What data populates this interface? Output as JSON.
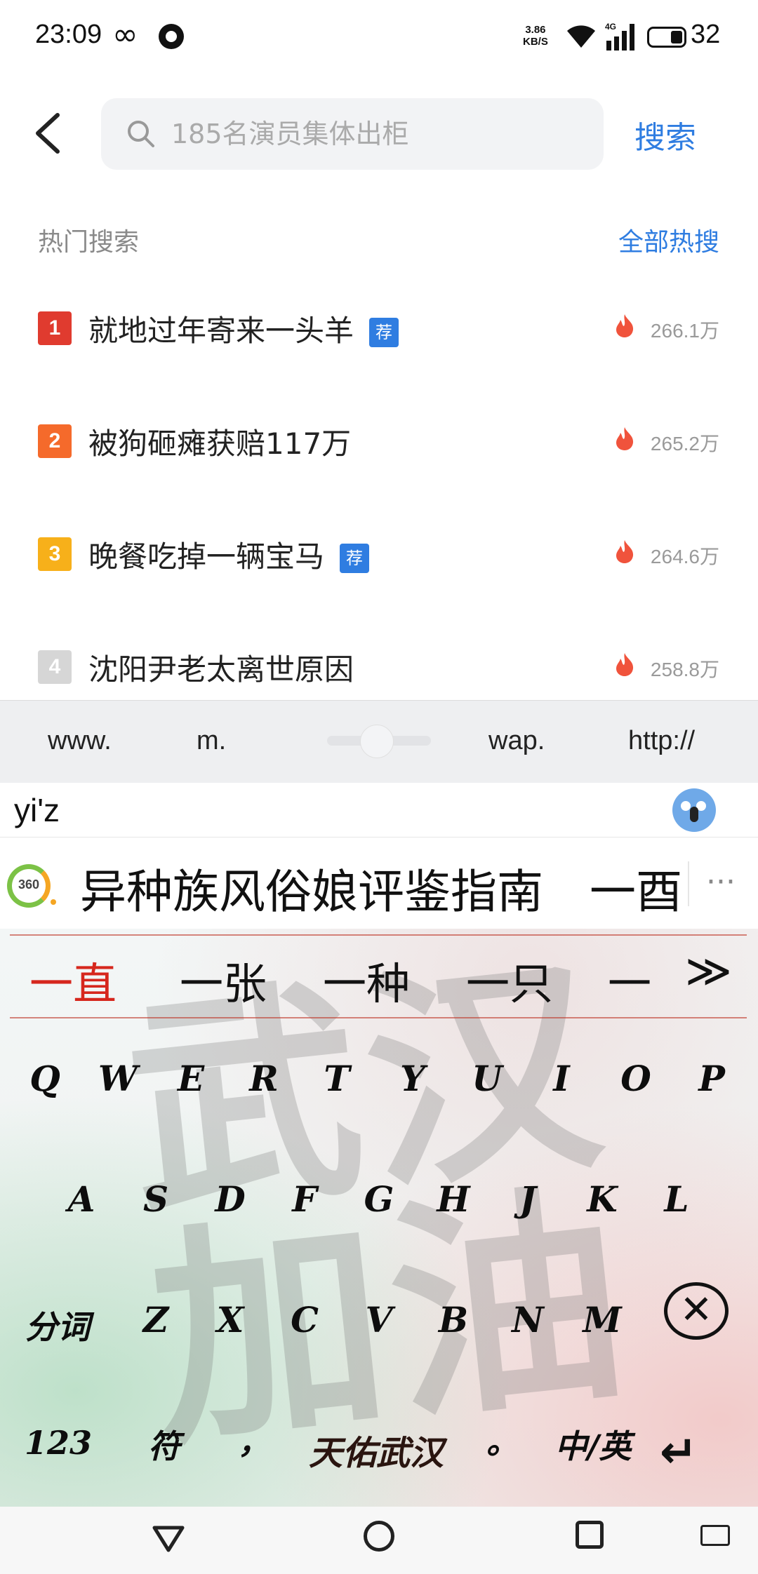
{
  "status_bar": {
    "time": "23:09",
    "net_speed_value": "3.86",
    "net_speed_unit": "KB/S",
    "battery": "32"
  },
  "search": {
    "placeholder": "185名演员集体出柜",
    "value": "",
    "button": "搜索"
  },
  "hot": {
    "title": "热门搜索",
    "all_link": "全部热搜",
    "items": [
      {
        "rank": "1",
        "text": "就地过年寄来一头羊",
        "badge": "荐",
        "count": "266.1万"
      },
      {
        "rank": "2",
        "text": "被狗砸瘫获赔117万",
        "badge": "",
        "count": "265.2万"
      },
      {
        "rank": "3",
        "text": "晚餐吃掉一辆宝马",
        "badge": "荐",
        "count": "264.6万"
      },
      {
        "rank": "4",
        "text": "沈阳尹老太离世原因",
        "badge": "",
        "count": "258.8万"
      }
    ]
  },
  "url_bar": {
    "keys": [
      "www.",
      "m.",
      "wap.",
      "http://"
    ]
  },
  "ime": {
    "composition": "yi'z",
    "suggestion": "异种族风俗娘评鉴指南　一酉",
    "logo_text": "360",
    "candidates": [
      "一直",
      "一张",
      "一种",
      "一只",
      "一"
    ],
    "row1": [
      "Q",
      "W",
      "E",
      "R",
      "T",
      "Y",
      "U",
      "I",
      "O",
      "P"
    ],
    "row2": [
      "A",
      "S",
      "D",
      "F",
      "G",
      "H",
      "J",
      "K",
      "L"
    ],
    "row3_left": "分词",
    "row3": [
      "Z",
      "X",
      "C",
      "V",
      "B",
      "N",
      "M"
    ],
    "row4": {
      "num": "123",
      "symbol": "符",
      "comma": "，",
      "brand": "天佑武汉",
      "period": "。",
      "lang": "中/英"
    },
    "watermark": "武汉加油"
  },
  "colors": {
    "accent": "#2f7de1",
    "rank1": "#e03b2f",
    "rank2": "#f56a2b",
    "rank3": "#f7b01a",
    "rank4": "#d6d6d6",
    "candidate_active": "#d6271d"
  }
}
